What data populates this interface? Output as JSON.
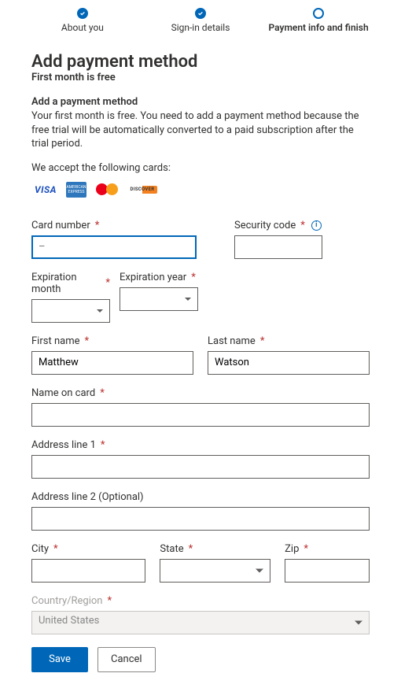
{
  "stepper": {
    "steps": [
      {
        "label": "About you",
        "state": "done"
      },
      {
        "label": "Sign-in details",
        "state": "done"
      },
      {
        "label": "Payment info and finish",
        "state": "current"
      }
    ]
  },
  "page": {
    "title": "Add payment method",
    "subtitle": "First month is free"
  },
  "section": {
    "title": "Add a payment method",
    "desc": "Your first month is free. You need to add a payment method because the free trial will be automatically converted to a paid subscription after the trial period.",
    "accept_text": "We accept the following cards:"
  },
  "cards": {
    "visa": "VISA",
    "amex": "AMERICAN EXPRESS",
    "discover": "DISCOVER"
  },
  "form": {
    "card_number": {
      "label": "Card number",
      "value": "–",
      "required": true
    },
    "security_code": {
      "label": "Security code",
      "value": "",
      "required": true,
      "info": true
    },
    "exp_month": {
      "label": "Expiration month",
      "selected": "",
      "required": true
    },
    "exp_year": {
      "label": "Expiration year",
      "selected": "",
      "required": true
    },
    "first_name": {
      "label": "First name",
      "value": "Matthew",
      "required": true
    },
    "last_name": {
      "label": "Last name",
      "value": "Watson",
      "required": true
    },
    "name_on_card": {
      "label": "Name on card",
      "value": "",
      "required": true
    },
    "address1": {
      "label": "Address line 1",
      "value": "",
      "required": true
    },
    "address2": {
      "label": "Address line 2 (Optional)",
      "value": "",
      "required": false
    },
    "city": {
      "label": "City",
      "value": "",
      "required": true
    },
    "state": {
      "label": "State",
      "selected": "",
      "required": true
    },
    "zip": {
      "label": "Zip",
      "value": "",
      "required": true
    },
    "country": {
      "label": "Country/Region",
      "selected": "United States",
      "required": true,
      "disabled": true
    }
  },
  "buttons": {
    "save": "Save",
    "cancel": "Cancel"
  }
}
